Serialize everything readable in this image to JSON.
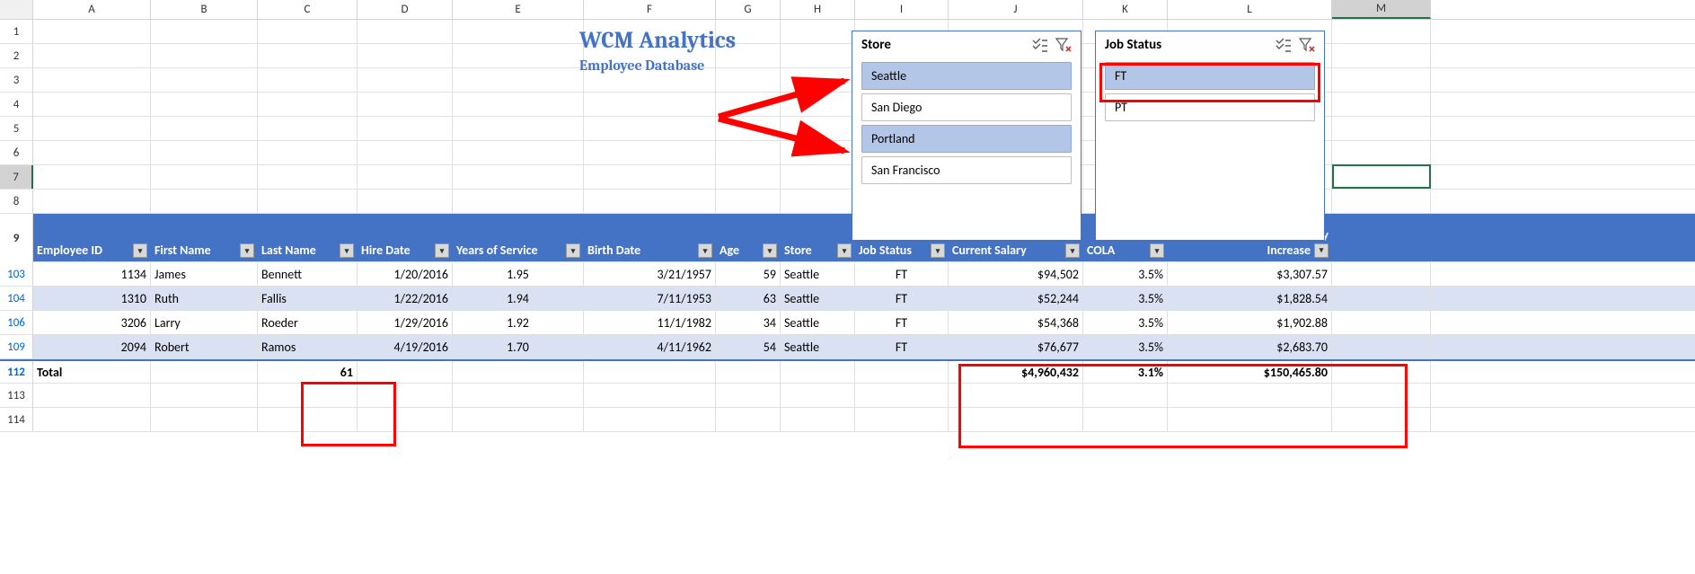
{
  "columns": [
    "A",
    "B",
    "C",
    "D",
    "E",
    "F",
    "G",
    "H",
    "I",
    "J",
    "K",
    "L",
    "M"
  ],
  "title": {
    "main": "WCM Analytics",
    "sub": "Employee Database"
  },
  "blank_row_nums": [
    "1",
    "2",
    "3",
    "4",
    "5",
    "6",
    "7",
    "8"
  ],
  "header_row_num": "9",
  "table_headers": {
    "A": "Employee ID",
    "B": "First Name",
    "C": "Last Name",
    "D": "Hire Date",
    "E": "Years of Service",
    "F": "Birth Date",
    "G": "Age",
    "H": "Store",
    "I": "Job Status",
    "J": "Current Salary",
    "K": "COLA",
    "L": "Projected Salary Increase"
  },
  "data_rows": [
    {
      "num": "103",
      "A": "1134",
      "B": "James",
      "C": "Bennett",
      "D": "1/20/2016",
      "E": "1.95",
      "F": "3/21/1957",
      "G": "59",
      "H": "Seattle",
      "I": "FT",
      "J": "$94,502",
      "K": "3.5%",
      "L": "$3,307.57",
      "band": false
    },
    {
      "num": "104",
      "A": "1310",
      "B": "Ruth",
      "C": "Fallis",
      "D": "1/22/2016",
      "E": "1.94",
      "F": "7/11/1953",
      "G": "63",
      "H": "Seattle",
      "I": "FT",
      "J": "$52,244",
      "K": "3.5%",
      "L": "$1,828.54",
      "band": true
    },
    {
      "num": "106",
      "A": "3206",
      "B": "Larry",
      "C": "Roeder",
      "D": "1/29/2016",
      "E": "1.92",
      "F": "11/1/1982",
      "G": "34",
      "H": "Seattle",
      "I": "FT",
      "J": "$54,368",
      "K": "3.5%",
      "L": "$1,902.88",
      "band": false
    },
    {
      "num": "109",
      "A": "2094",
      "B": "Robert",
      "C": "Ramos",
      "D": "4/19/2016",
      "E": "1.70",
      "F": "4/11/1962",
      "G": "54",
      "H": "Seattle",
      "I": "FT",
      "J": "$76,677",
      "K": "3.5%",
      "L": "$2,683.70",
      "band": true
    }
  ],
  "total_row": {
    "num": "112",
    "label": "Total",
    "C": "61",
    "J": "$4,960,432",
    "K": "3.1%",
    "L": "$150,465.80"
  },
  "trailing_rows": [
    "113",
    "114"
  ],
  "slicers": {
    "store": {
      "title": "Store",
      "items": [
        {
          "label": "Seattle",
          "selected": true
        },
        {
          "label": "San Diego",
          "selected": false
        },
        {
          "label": "Portland",
          "selected": true
        },
        {
          "label": "San Francisco",
          "selected": false
        }
      ]
    },
    "job": {
      "title": "Job Status",
      "items": [
        {
          "label": "FT",
          "selected": true
        },
        {
          "label": "PT",
          "selected": false
        }
      ]
    }
  }
}
